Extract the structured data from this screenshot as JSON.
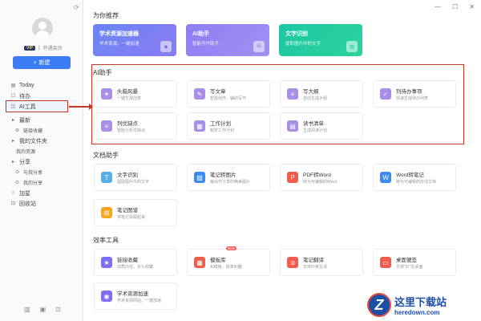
{
  "window": {
    "refresh_icon": "refresh-icon",
    "controls": [
      "—",
      "☐",
      "✕"
    ]
  },
  "user": {
    "vip_badge": "VIP",
    "member_link": "开通会员"
  },
  "new_button": {
    "label": "新建"
  },
  "sidebar": {
    "items": [
      {
        "label": "Today",
        "icon": "▤"
      },
      {
        "label": "待办",
        "icon": "☐"
      },
      {
        "label": "AI工具",
        "icon": "◫"
      },
      {
        "label": "最新",
        "icon": "▸"
      },
      {
        "label": "链接收藏",
        "icon": "⊘"
      },
      {
        "label": "我的文件夹",
        "icon": "▸"
      },
      {
        "label": "我的资源",
        "icon": ""
      },
      {
        "label": "分享",
        "icon": "▸"
      },
      {
        "label": "与我分享",
        "icon": "⊙"
      },
      {
        "label": "我的分享",
        "icon": "⊙"
      },
      {
        "label": "加星",
        "icon": "☆"
      },
      {
        "label": "回收站",
        "icon": "⊡"
      }
    ],
    "bottom_icons": [
      "▥",
      "▣",
      "⊡"
    ]
  },
  "recommend": {
    "title": "为你推荐",
    "cards": [
      {
        "title": "学术资源加速器",
        "sub": "学术资源，一键加速",
        "color": "#6f7bf0"
      },
      {
        "title": "AI助手",
        "sub": "智能写作助手",
        "color": "#7d6ff0"
      },
      {
        "title": "文字识别",
        "sub": "提取图片中的文字",
        "color": "#1fc49a"
      }
    ]
  },
  "ai": {
    "title": "AI助手",
    "tools": [
      {
        "title": "头脑风暴",
        "sub": "一键生成创意",
        "icon": "✦",
        "color": "#a98ee8"
      },
      {
        "title": "写文章",
        "sub": "智能创作，辅助写作",
        "icon": "✎",
        "color": "#a98ee8"
      },
      {
        "title": "写大纲",
        "sub": "自动生成大纲",
        "icon": "≡",
        "color": "#a98ee8"
      },
      {
        "title": "列待办事项",
        "sub": "快速生成待办列表",
        "icon": "✓",
        "color": "#a98ee8"
      },
      {
        "title": "列优缺点",
        "sub": "智能分析优缺点",
        "icon": "≡",
        "color": "#a98ee8"
      },
      {
        "title": "工作计划",
        "sub": "制定工作计划",
        "icon": "▦",
        "color": "#a98ee8"
      },
      {
        "title": "读书清单",
        "sub": "生成阅读计划",
        "icon": "▤",
        "color": "#a98ee8"
      }
    ]
  },
  "doc": {
    "title": "文档助手",
    "tools": [
      {
        "title": "文字识别",
        "sub": "提取图片中的文字",
        "icon": "T",
        "color": "#5aaee8"
      },
      {
        "title": "笔记转图片",
        "sub": "输出可分享的精美图片",
        "icon": "▧",
        "color": "#3d8bf0"
      },
      {
        "title": "PDF转Word",
        "sub": "转为可编辑的Word",
        "icon": "P",
        "color": "#ef5d4f"
      },
      {
        "title": "Word转笔记",
        "sub": "转为可编辑的在线文档",
        "icon": "W",
        "color": "#3d8bf0"
      },
      {
        "title": "笔记图谱",
        "sub": "将笔记关联起来",
        "icon": "⊞",
        "color": "#f5a623"
      }
    ]
  },
  "efficiency": {
    "title": "效率工具",
    "tools": [
      {
        "title": "链接收藏",
        "sub": "优质内容，永久收藏",
        "icon": "★",
        "color": "#7d6ff0"
      },
      {
        "title": "模板库",
        "sub": "AI模板，效率利器",
        "icon": "▦",
        "color": "#ef5d4f",
        "badge": "New"
      },
      {
        "title": "笔记翻译",
        "sub": "支持中英互译",
        "icon": "译",
        "color": "#ef5d4f"
      },
      {
        "title": "桌面便签",
        "sub": "灵感\"钉\"在桌面",
        "icon": "▭",
        "color": "#ef5d4f"
      },
      {
        "title": "学术资源加速",
        "sub": "学术资源网站，一键加速",
        "icon": "◉",
        "color": "#7d6ff0"
      }
    ]
  },
  "watermark": {
    "cn": "这里下载站",
    "url": "heredown.com",
    "logo": "Z"
  }
}
